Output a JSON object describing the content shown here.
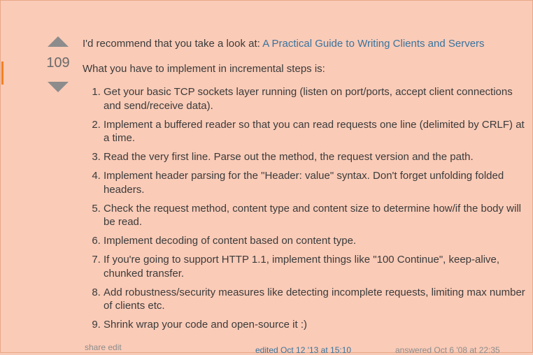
{
  "vote": {
    "count": "109"
  },
  "post": {
    "intro_text": "I'd recommend that you take a look at: ",
    "intro_link": "A Practical Guide to Writing Clients and Servers",
    "lead": "What you have to implement in incremental steps is:",
    "steps": [
      "Get your basic TCP sockets layer running (listen on port/ports, accept client connections and send/receive data).",
      "Implement a buffered reader so that you can read requests one line (delimited by CRLF) at a time.",
      "Read the very first line. Parse out the method, the request version and the path.",
      "Implement header parsing for the \"Header: value\" syntax. Don't forget unfolding folded headers.",
      "Check the request method, content type and content size to determine how/if the body will be read.",
      "Implement decoding of content based on content type.",
      "If you're going to support HTTP 1.1, implement things like \"100 Continue\", keep-alive, chunked transfer.",
      "Add robustness/security measures like detecting incomplete requests, limiting max number of clients etc.",
      "Shrink wrap your code and open-source it :)"
    ]
  },
  "menu": {
    "share": "share",
    "edit": "edit"
  },
  "signature": {
    "edited": "edited Oct 12 '13 at 15:10",
    "answered": "answered Oct 6 '08 at 22:35"
  },
  "colors": {
    "background": "#facbb7",
    "accent": "#f48024",
    "link": "#39739d"
  },
  "icons": {
    "upvote": "arrow-up-icon",
    "downvote": "arrow-down-icon"
  }
}
